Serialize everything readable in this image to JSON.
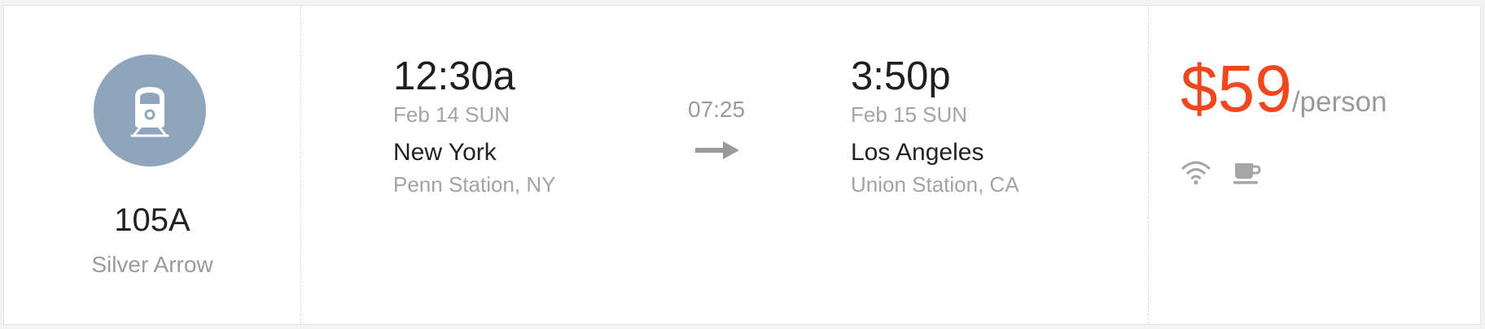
{
  "train": {
    "icon": "train-icon",
    "number": "105A",
    "name": "Silver Arrow"
  },
  "departure": {
    "time": "12:30a",
    "date": "Feb 14 SUN",
    "city": "New York",
    "station": "Penn Station, NY"
  },
  "duration": "07:25",
  "arrival": {
    "time": "3:50p",
    "date": "Feb 15 SUN",
    "city": "Los Angeles",
    "station": "Union Station, CA"
  },
  "price": {
    "value": "$59",
    "unit": "/person"
  },
  "amenities": [
    "wifi-icon",
    "coffee-cup-icon"
  ],
  "colors": {
    "accent": "#f1471d",
    "icon_circle": "#8fa5bc",
    "muted_text": "#9a9a9a",
    "primary_text": "#222222"
  }
}
